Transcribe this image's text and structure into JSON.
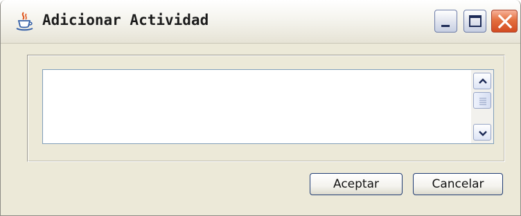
{
  "window": {
    "title": "Adicionar Actividad",
    "icon": "java-cup-icon",
    "controls": [
      "minimize-icon",
      "maximize-icon",
      "close-icon"
    ]
  },
  "text_area": {
    "value": ""
  },
  "buttons": {
    "accept_label": "Aceptar",
    "cancel_label": "Cancelar"
  },
  "colors": {
    "window_background": "#ece9d8",
    "close_button": "#d34b21",
    "textarea_border": "#7f9db9"
  }
}
